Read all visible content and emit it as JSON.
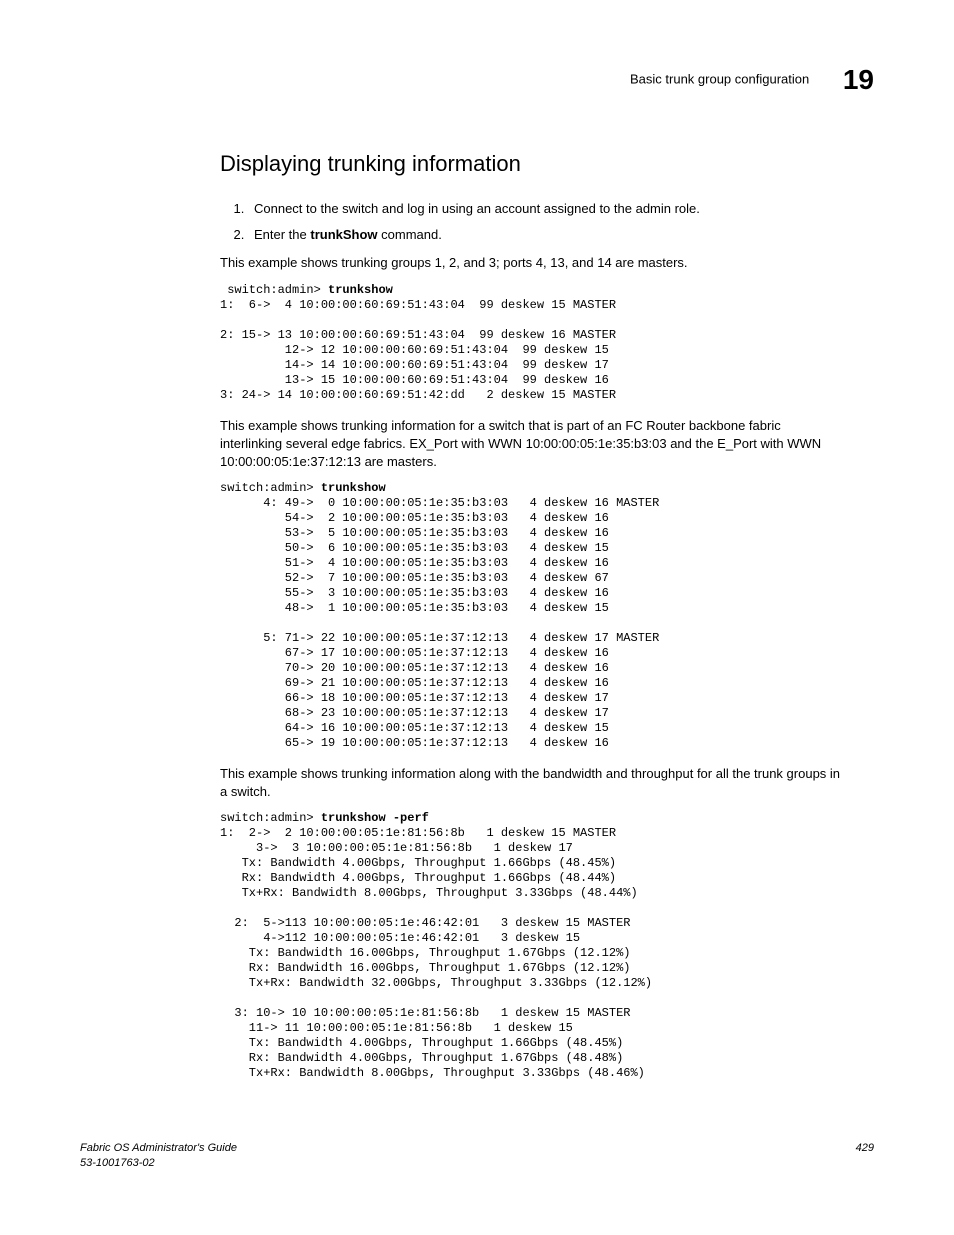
{
  "header": {
    "title": "Basic trunk group configuration",
    "chapter": "19"
  },
  "heading": "Displaying trunking information",
  "steps": [
    "Connect to the switch and log in using an account assigned to the admin role.",
    "Enter the <b>trunkShow</b> command."
  ],
  "desc1": "This example shows trunking groups 1, 2, and 3; ports 4, 13, and 14 are masters.",
  "code1_prompt": " switch:admin> ",
  "code1_cmd": "trunkshow",
  "code1_body": "1:  6->  4 10:00:00:60:69:51:43:04  99 deskew 15 MASTER\n\n2: 15-> 13 10:00:00:60:69:51:43:04  99 deskew 16 MASTER\n         12-> 12 10:00:00:60:69:51:43:04  99 deskew 15\n         14-> 14 10:00:00:60:69:51:43:04  99 deskew 17\n         13-> 15 10:00:00:60:69:51:43:04  99 deskew 16\n3: 24-> 14 10:00:00:60:69:51:42:dd   2 deskew 15 MASTER",
  "desc2": "This example shows trunking information for a switch that is part of an FC Router backbone fabric interlinking several edge fabrics. EX_Port with WWN 10:00:00:05:1e:35:b3:03 and the E_Port with WWN 10:00:00:05:1e:37:12:13 are masters.",
  "code2_prompt": "switch:admin> ",
  "code2_cmd": "trunkshow",
  "code2_body": "      4: 49->  0 10:00:00:05:1e:35:b3:03   4 deskew 16 MASTER\n         54->  2 10:00:00:05:1e:35:b3:03   4 deskew 16\n         53->  5 10:00:00:05:1e:35:b3:03   4 deskew 16\n         50->  6 10:00:00:05:1e:35:b3:03   4 deskew 15\n         51->  4 10:00:00:05:1e:35:b3:03   4 deskew 16\n         52->  7 10:00:00:05:1e:35:b3:03   4 deskew 67\n         55->  3 10:00:00:05:1e:35:b3:03   4 deskew 16\n         48->  1 10:00:00:05:1e:35:b3:03   4 deskew 15\n\n      5: 71-> 22 10:00:00:05:1e:37:12:13   4 deskew 17 MASTER\n         67-> 17 10:00:00:05:1e:37:12:13   4 deskew 16\n         70-> 20 10:00:00:05:1e:37:12:13   4 deskew 16\n         69-> 21 10:00:00:05:1e:37:12:13   4 deskew 16\n         66-> 18 10:00:00:05:1e:37:12:13   4 deskew 17\n         68-> 23 10:00:00:05:1e:37:12:13   4 deskew 17\n         64-> 16 10:00:00:05:1e:37:12:13   4 deskew 15\n         65-> 19 10:00:00:05:1e:37:12:13   4 deskew 16",
  "desc3": "This example shows trunking information along with the bandwidth and throughput for all the trunk groups in a switch.",
  "code3_prompt": "switch:admin> ",
  "code3_cmd": "trunkshow -perf",
  "code3_body": "1:  2->  2 10:00:00:05:1e:81:56:8b   1 deskew 15 MASTER\n     3->  3 10:00:00:05:1e:81:56:8b   1 deskew 17\n   Tx: Bandwidth 4.00Gbps, Throughput 1.66Gbps (48.45%)\n   Rx: Bandwidth 4.00Gbps, Throughput 1.66Gbps (48.44%)\n   Tx+Rx: Bandwidth 8.00Gbps, Throughput 3.33Gbps (48.44%)\n\n  2:  5->113 10:00:00:05:1e:46:42:01   3 deskew 15 MASTER\n      4->112 10:00:00:05:1e:46:42:01   3 deskew 15\n    Tx: Bandwidth 16.00Gbps, Throughput 1.67Gbps (12.12%)\n    Rx: Bandwidth 16.00Gbps, Throughput 1.67Gbps (12.12%)\n    Tx+Rx: Bandwidth 32.00Gbps, Throughput 3.33Gbps (12.12%)\n\n  3: 10-> 10 10:00:00:05:1e:81:56:8b   1 deskew 15 MASTER\n    11-> 11 10:00:00:05:1e:81:56:8b   1 deskew 15\n    Tx: Bandwidth 4.00Gbps, Throughput 1.66Gbps (48.45%)\n    Rx: Bandwidth 4.00Gbps, Throughput 1.67Gbps (48.48%)\n    Tx+Rx: Bandwidth 8.00Gbps, Throughput 3.33Gbps (48.46%)",
  "footer": {
    "left_line1": "Fabric OS Administrator's Guide",
    "left_line2": "53-1001763-02",
    "right": "429"
  }
}
